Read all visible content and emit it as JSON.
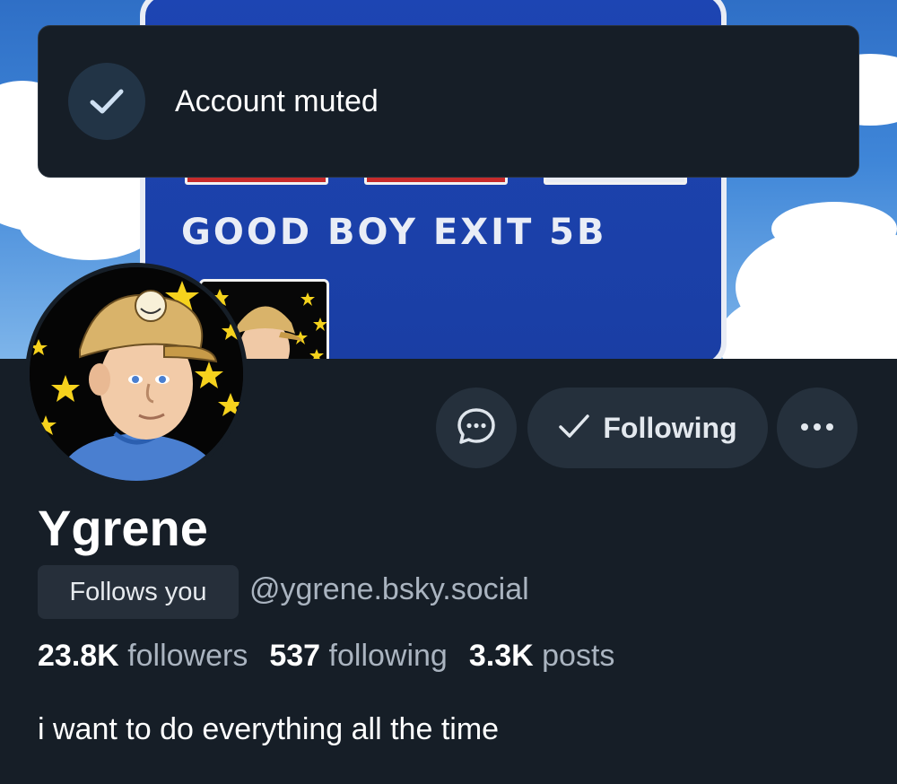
{
  "banner": {
    "sign_text": "GOOD BOY EXIT 5B"
  },
  "toast": {
    "message": "Account muted",
    "icon": "checkmark-icon"
  },
  "actions": {
    "message_icon": "chat-bubble-icon",
    "following_label": "Following",
    "following_icon": "checkmark-icon",
    "more_icon": "ellipsis-icon"
  },
  "profile": {
    "display_name": "Ygrene",
    "follows_you_label": "Follows you",
    "handle": "@ygrene.bsky.social",
    "stats": {
      "followers_count": "23.8K",
      "followers_label": "followers",
      "following_count": "537",
      "following_label": "following",
      "posts_count": "3.3K",
      "posts_label": "posts"
    },
    "bio": "i want to do everything all the time"
  },
  "colors": {
    "background": "#161e27",
    "button_bg": "#25303c",
    "badge_bg": "#262f3a",
    "muted_text": "#aab4c0",
    "toast_check_bg": "#223446",
    "sign_blue": "#1d45b3"
  }
}
